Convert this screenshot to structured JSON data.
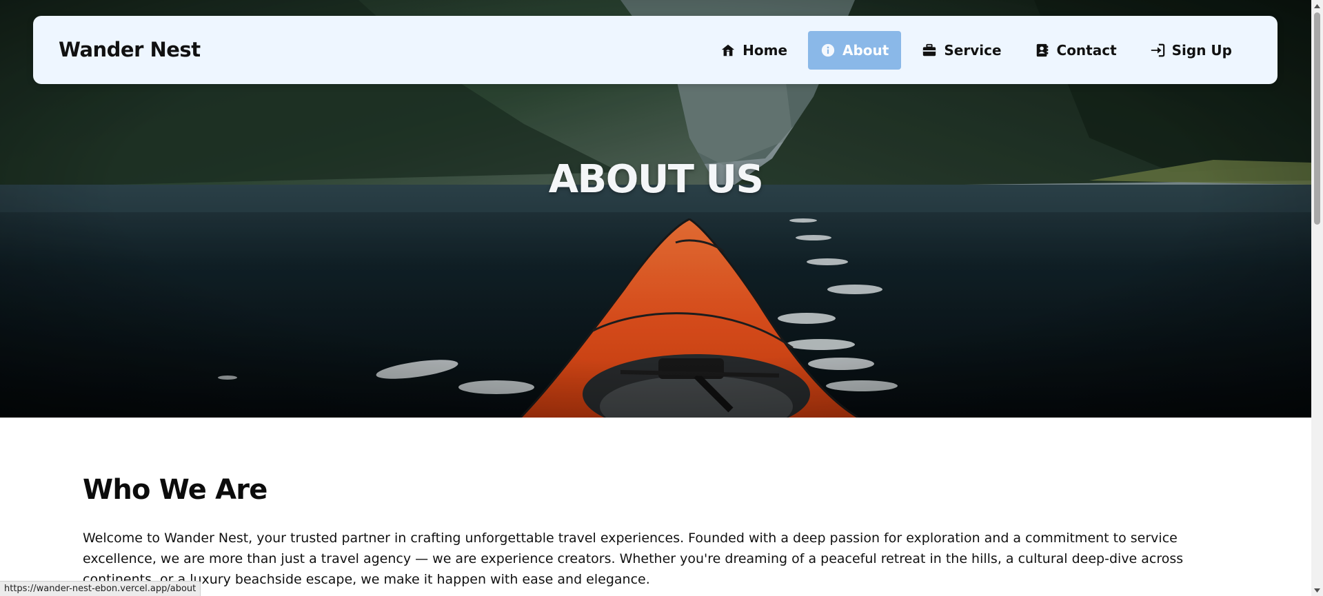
{
  "brand": "Wander Nest",
  "nav": {
    "items": [
      {
        "label": "Home",
        "icon": "home-icon",
        "active": false
      },
      {
        "label": "About",
        "icon": "info-icon",
        "active": true
      },
      {
        "label": "Service",
        "icon": "briefcase-icon",
        "active": false
      },
      {
        "label": "Contact",
        "icon": "contact-book-icon",
        "active": false
      },
      {
        "label": "Sign Up",
        "icon": "sign-in-icon",
        "active": false
      }
    ]
  },
  "hero": {
    "title": "ABOUT US"
  },
  "about": {
    "heading": "Who We Are",
    "paragraph": "Welcome to Wander Nest, your trusted partner in crafting unforgettable travel experiences. Founded with a deep passion for exploration and a commitment to service excellence, we are more than just a travel agency — we are experience creators. Whether you're dreaming of a peaceful retreat in the hills, a cultural deep-dive across continents, or a luxury beachside escape, we make it happen with ease and elegance."
  },
  "status_bar": {
    "url": "https://wander-nest-ebon.vercel.app/about"
  },
  "colors": {
    "navbar_bg": "#eef6ff",
    "active_nav_bg": "#8ab8e8",
    "kayak_orange": "#f0521f"
  }
}
